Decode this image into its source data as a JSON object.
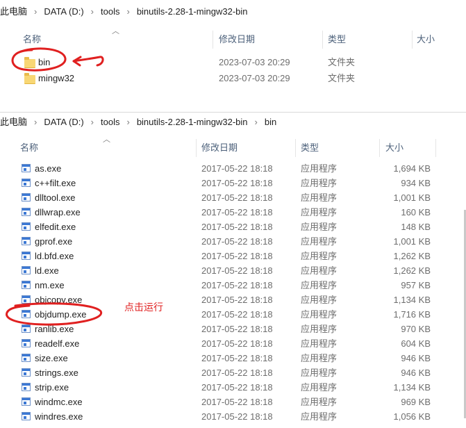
{
  "top_window": {
    "breadcrumb": [
      "此电脑",
      "DATA (D:)",
      "tools",
      "binutils-2.28-1-mingw32-bin"
    ],
    "columns": {
      "name": "名称",
      "modified": "修改日期",
      "type": "类型",
      "size": "大小"
    },
    "items": [
      {
        "name": "bin",
        "modified": "2023-07-03 20:29",
        "type": "文件夹"
      },
      {
        "name": "mingw32",
        "modified": "2023-07-03 20:29",
        "type": "文件夹"
      }
    ]
  },
  "bottom_window": {
    "breadcrumb": [
      "此电脑",
      "DATA (D:)",
      "tools",
      "binutils-2.28-1-mingw32-bin",
      "bin"
    ],
    "columns": {
      "name": "名称",
      "modified": "修改日期",
      "type": "类型",
      "size": "大小"
    },
    "files": [
      {
        "name": "as.exe",
        "modified": "2017-05-22 18:18",
        "type": "应用程序",
        "size": "1,694 KB"
      },
      {
        "name": "c++filt.exe",
        "modified": "2017-05-22 18:18",
        "type": "应用程序",
        "size": "934 KB"
      },
      {
        "name": "dlltool.exe",
        "modified": "2017-05-22 18:18",
        "type": "应用程序",
        "size": "1,001 KB"
      },
      {
        "name": "dllwrap.exe",
        "modified": "2017-05-22 18:18",
        "type": "应用程序",
        "size": "160 KB"
      },
      {
        "name": "elfedit.exe",
        "modified": "2017-05-22 18:18",
        "type": "应用程序",
        "size": "148 KB"
      },
      {
        "name": "gprof.exe",
        "modified": "2017-05-22 18:18",
        "type": "应用程序",
        "size": "1,001 KB"
      },
      {
        "name": "ld.bfd.exe",
        "modified": "2017-05-22 18:18",
        "type": "应用程序",
        "size": "1,262 KB"
      },
      {
        "name": "ld.exe",
        "modified": "2017-05-22 18:18",
        "type": "应用程序",
        "size": "1,262 KB"
      },
      {
        "name": "nm.exe",
        "modified": "2017-05-22 18:18",
        "type": "应用程序",
        "size": "957 KB"
      },
      {
        "name": "objcopy.exe",
        "modified": "2017-05-22 18:18",
        "type": "应用程序",
        "size": "1,134 KB"
      },
      {
        "name": "objdump.exe",
        "modified": "2017-05-22 18:18",
        "type": "应用程序",
        "size": "1,716 KB"
      },
      {
        "name": "ranlib.exe",
        "modified": "2017-05-22 18:18",
        "type": "应用程序",
        "size": "970 KB"
      },
      {
        "name": "readelf.exe",
        "modified": "2017-05-22 18:18",
        "type": "应用程序",
        "size": "604 KB"
      },
      {
        "name": "size.exe",
        "modified": "2017-05-22 18:18",
        "type": "应用程序",
        "size": "946 KB"
      },
      {
        "name": "strings.exe",
        "modified": "2017-05-22 18:18",
        "type": "应用程序",
        "size": "946 KB"
      },
      {
        "name": "strip.exe",
        "modified": "2017-05-22 18:18",
        "type": "应用程序",
        "size": "1,134 KB"
      },
      {
        "name": "windmc.exe",
        "modified": "2017-05-22 18:18",
        "type": "应用程序",
        "size": "969 KB"
      },
      {
        "name": "windres.exe",
        "modified": "2017-05-22 18:18",
        "type": "应用程序",
        "size": "1,056 KB"
      }
    ]
  },
  "annotation": {
    "label": "点击运行",
    "color": "#e02020"
  },
  "icons": {
    "folder": "folder-icon",
    "exe": "exe-file-icon",
    "separator": "chevron-right-icon",
    "sort": "sort-up-icon"
  }
}
